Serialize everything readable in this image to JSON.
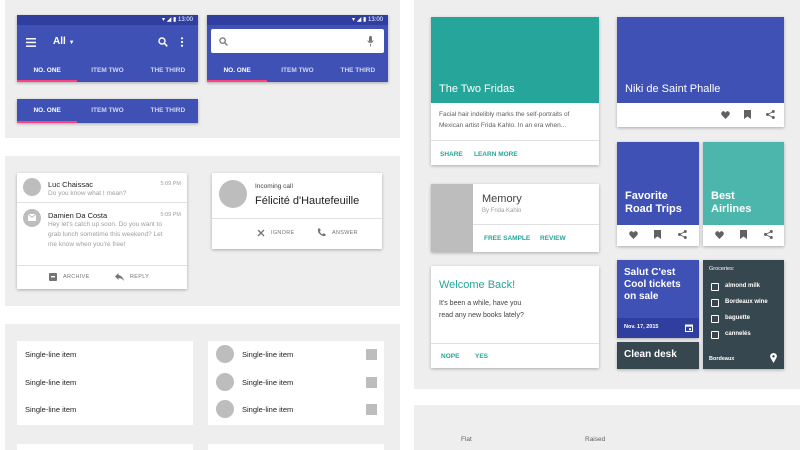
{
  "status": {
    "time": "13:00"
  },
  "appbar": {
    "dropdown_label": "All"
  },
  "tabs": [
    "No. One",
    "Item Two",
    "The Third"
  ],
  "emails": [
    {
      "name": "Luc Chaissac",
      "time": "5:09 PM",
      "preview": "Do you know what I mean?"
    },
    {
      "name": "Damien Da Costa",
      "time": "5:09 PM",
      "preview_lines": [
        "Hey let's catch up soon. Do you want to",
        "grab lunch sometime this weekend? Let",
        "me know when you're free!"
      ]
    }
  ],
  "email_actions": {
    "archive": "Archive",
    "reply": "Reply"
  },
  "call": {
    "label": "Incoming call",
    "caller": "Félicité d'Hautefeuille",
    "ignore": "Ignore",
    "answer": "Answer"
  },
  "list_items": [
    "Single-line item",
    "Single-line item",
    "Single-line item"
  ],
  "cards": {
    "fridas": {
      "title": "The Two Fridas",
      "body_lines": [
        "Facial hair indelibly marks the self-portraits of",
        "Mexican artist Frida Kahlo. In an era when..."
      ],
      "share": "Share",
      "learn": "Learn more"
    },
    "niki": {
      "title": "Niki de Saint Phalle"
    },
    "memory": {
      "title": "Memory",
      "subtitle": "By Frida Kahlo",
      "free": "Free sample",
      "review": "Review"
    },
    "road": {
      "title_lines": [
        "Favorite",
        "Road Trips"
      ]
    },
    "airlines": {
      "title_lines": [
        "Best",
        "Airlines"
      ]
    },
    "welcome": {
      "title": "Welcome Back!",
      "body_lines": [
        "It's been a while, have you",
        "read any new books lately?"
      ],
      "nope": "Nope",
      "yes": "Yes"
    },
    "salut": {
      "title_lines": [
        "Salut C'est",
        "Cool tickets",
        "on sale"
      ],
      "date": "Nov. 17, 2015"
    },
    "clean": {
      "title": "Clean desk"
    },
    "groceries": {
      "header": "Groceries:",
      "items": [
        "almond milk",
        "Bordeaux wine",
        "baguette",
        "cannelés"
      ],
      "footer": "Bordeaux"
    }
  },
  "buttons_section": {
    "flat": "Flat",
    "raised": "Raised"
  },
  "colors": {
    "indigo": "#3f51b5",
    "teal": "#26a69a",
    "pink": "#ff4081",
    "slate": "#37474f"
  }
}
